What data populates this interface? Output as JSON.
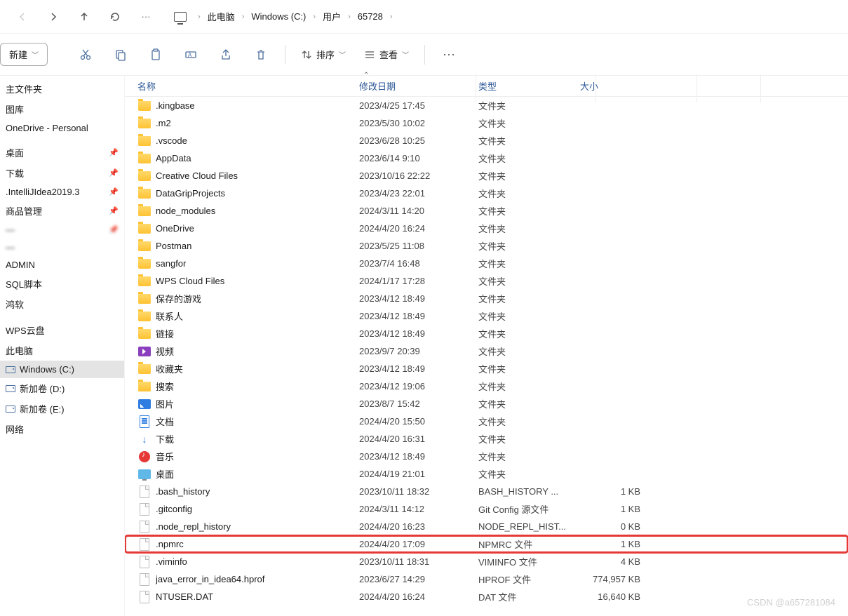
{
  "nav": {
    "more": "···"
  },
  "breadcrumb": {
    "items": [
      "此电脑",
      "Windows  (C:)",
      "用户",
      "65728"
    ]
  },
  "toolbar": {
    "new_label": "新建",
    "sort_label": "排序",
    "view_label": "查看"
  },
  "sidebar": {
    "groups": [
      {
        "items": [
          {
            "label": "主文件夹"
          },
          {
            "label": "图库"
          },
          {
            "label": "OneDrive - Personal"
          }
        ]
      },
      {
        "items": [
          {
            "label": "桌面",
            "pinned": true
          },
          {
            "label": "下载",
            "pinned": true
          },
          {
            "label": ".IntelliJIdea2019.3",
            "pinned": true
          },
          {
            "label": "商品管理",
            "pinned": true
          },
          {
            "label": "",
            "pinned": true,
            "blur": true
          },
          {
            "label": "",
            "blur": true
          },
          {
            "label": "ADMIN"
          },
          {
            "label": "SQL脚本"
          },
          {
            "label": "鸿软"
          }
        ]
      },
      {
        "items": [
          {
            "label": "WPS云盘"
          },
          {
            "label": "此电脑"
          },
          {
            "label": "Windows  (C:)",
            "active": true,
            "drive": true
          },
          {
            "label": "新加卷 (D:)",
            "drive": true
          },
          {
            "label": "新加卷 (E:)",
            "drive": true
          },
          {
            "label": "网络"
          }
        ]
      }
    ]
  },
  "columns": {
    "name": "名称",
    "date": "修改日期",
    "type": "类型",
    "size": "大小"
  },
  "rows": [
    {
      "icon": "folder",
      "name": ".kingbase",
      "date": "2023/4/25 17:45",
      "type": "文件夹",
      "size": ""
    },
    {
      "icon": "folder",
      "name": ".m2",
      "date": "2023/5/30 10:02",
      "type": "文件夹",
      "size": ""
    },
    {
      "icon": "folder",
      "name": ".vscode",
      "date": "2023/6/28 10:25",
      "type": "文件夹",
      "size": ""
    },
    {
      "icon": "folder",
      "name": "AppData",
      "date": "2023/6/14 9:10",
      "type": "文件夹",
      "size": ""
    },
    {
      "icon": "folder",
      "name": "Creative Cloud Files",
      "date": "2023/10/16 22:22",
      "type": "文件夹",
      "size": ""
    },
    {
      "icon": "folder",
      "name": "DataGripProjects",
      "date": "2023/4/23 22:01",
      "type": "文件夹",
      "size": ""
    },
    {
      "icon": "folder",
      "name": "node_modules",
      "date": "2024/3/11 14:20",
      "type": "文件夹",
      "size": ""
    },
    {
      "icon": "folder",
      "name": "OneDrive",
      "date": "2024/4/20 16:24",
      "type": "文件夹",
      "size": ""
    },
    {
      "icon": "folder",
      "name": "Postman",
      "date": "2023/5/25 11:08",
      "type": "文件夹",
      "size": ""
    },
    {
      "icon": "folder",
      "name": "sangfor",
      "date": "2023/7/4 16:48",
      "type": "文件夹",
      "size": ""
    },
    {
      "icon": "folder",
      "name": "WPS Cloud Files",
      "date": "2024/1/17 17:28",
      "type": "文件夹",
      "size": ""
    },
    {
      "icon": "folder",
      "name": "保存的游戏",
      "date": "2023/4/12 18:49",
      "type": "文件夹",
      "size": ""
    },
    {
      "icon": "folder",
      "name": "联系人",
      "date": "2023/4/12 18:49",
      "type": "文件夹",
      "size": ""
    },
    {
      "icon": "folder",
      "name": "链接",
      "date": "2023/4/12 18:49",
      "type": "文件夹",
      "size": ""
    },
    {
      "icon": "video",
      "name": "视频",
      "date": "2023/9/7 20:39",
      "type": "文件夹",
      "size": ""
    },
    {
      "icon": "folder",
      "name": "收藏夹",
      "date": "2023/4/12 18:49",
      "type": "文件夹",
      "size": ""
    },
    {
      "icon": "folder",
      "name": "搜索",
      "date": "2023/4/12 19:06",
      "type": "文件夹",
      "size": ""
    },
    {
      "icon": "picture",
      "name": "图片",
      "date": "2023/8/7 15:42",
      "type": "文件夹",
      "size": ""
    },
    {
      "icon": "doc",
      "name": "文档",
      "date": "2024/4/20 15:50",
      "type": "文件夹",
      "size": ""
    },
    {
      "icon": "download",
      "name": "下载",
      "date": "2024/4/20 16:31",
      "type": "文件夹",
      "size": ""
    },
    {
      "icon": "music",
      "name": "音乐",
      "date": "2023/4/12 18:49",
      "type": "文件夹",
      "size": ""
    },
    {
      "icon": "desktop",
      "name": "桌面",
      "date": "2024/4/19 21:01",
      "type": "文件夹",
      "size": ""
    },
    {
      "icon": "file",
      "name": ".bash_history",
      "date": "2023/10/11 18:32",
      "type": "BASH_HISTORY ...",
      "size": "1 KB"
    },
    {
      "icon": "file",
      "name": ".gitconfig",
      "date": "2024/3/11 14:12",
      "type": "Git Config 源文件",
      "size": "1 KB"
    },
    {
      "icon": "file",
      "name": ".node_repl_history",
      "date": "2024/4/20 16:23",
      "type": "NODE_REPL_HIST...",
      "size": "0 KB"
    },
    {
      "icon": "file",
      "name": ".npmrc",
      "date": "2024/4/20 17:09",
      "type": "NPMRC 文件",
      "size": "1 KB",
      "hl": true
    },
    {
      "icon": "file",
      "name": ".viminfo",
      "date": "2023/10/11 18:31",
      "type": "VIMINFO 文件",
      "size": "4 KB"
    },
    {
      "icon": "file",
      "name": "java_error_in_idea64.hprof",
      "date": "2023/6/27 14:29",
      "type": "HPROF 文件",
      "size": "774,957 KB"
    },
    {
      "icon": "file",
      "name": "NTUSER.DAT",
      "date": "2024/4/20 16:24",
      "type": "DAT 文件",
      "size": "16,640 KB"
    }
  ],
  "watermark": "CSDN @a657281084"
}
